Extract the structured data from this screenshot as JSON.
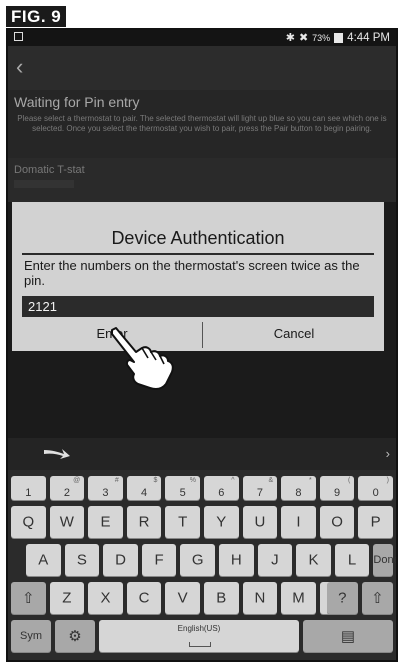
{
  "figure_label": "FIG. 9",
  "status_bar": {
    "battery_percent": "73%",
    "time": "4:44 PM",
    "icons": [
      "bluetooth-icon",
      "mute-icon",
      "battery-icon"
    ]
  },
  "pairing": {
    "title": "Waiting for Pin entry",
    "description": "Please select a thermostat to pair. The selected thermostat will light up blue so you can see which one is selected. Once you select the thermostat you wish to pair, press the Pair button to begin pairing.",
    "thermostat_item": "Domatic T-stat"
  },
  "dialog": {
    "title": "Device Authentication",
    "message": "Enter the numbers on the thermostat's screen twice as the pin.",
    "pin_value": "2121",
    "enter_label": "Enter",
    "cancel_label": "Cancel"
  },
  "keyboard": {
    "number_row": [
      {
        "key": "1",
        "sup": ""
      },
      {
        "key": "2",
        "sup": "@"
      },
      {
        "key": "3",
        "sup": "#"
      },
      {
        "key": "4",
        "sup": "$"
      },
      {
        "key": "5",
        "sup": "%"
      },
      {
        "key": "6",
        "sup": "^"
      },
      {
        "key": "7",
        "sup": "&"
      },
      {
        "key": "8",
        "sup": "*"
      },
      {
        "key": "9",
        "sup": "("
      },
      {
        "key": "0",
        "sup": ")"
      }
    ],
    "row1": [
      "Q",
      "W",
      "E",
      "R",
      "T",
      "Y",
      "U",
      "I",
      "O",
      "P"
    ],
    "row2": [
      "A",
      "S",
      "D",
      "F",
      "G",
      "H",
      "J",
      "K",
      "L"
    ],
    "row3": [
      "Z",
      "X",
      "C",
      "V",
      "B",
      "N",
      "M"
    ],
    "done_label": "Done",
    "sym_label": "Sym",
    "language_label": "English(US)",
    "comma": ",",
    "excl": "!",
    "question": "?"
  }
}
